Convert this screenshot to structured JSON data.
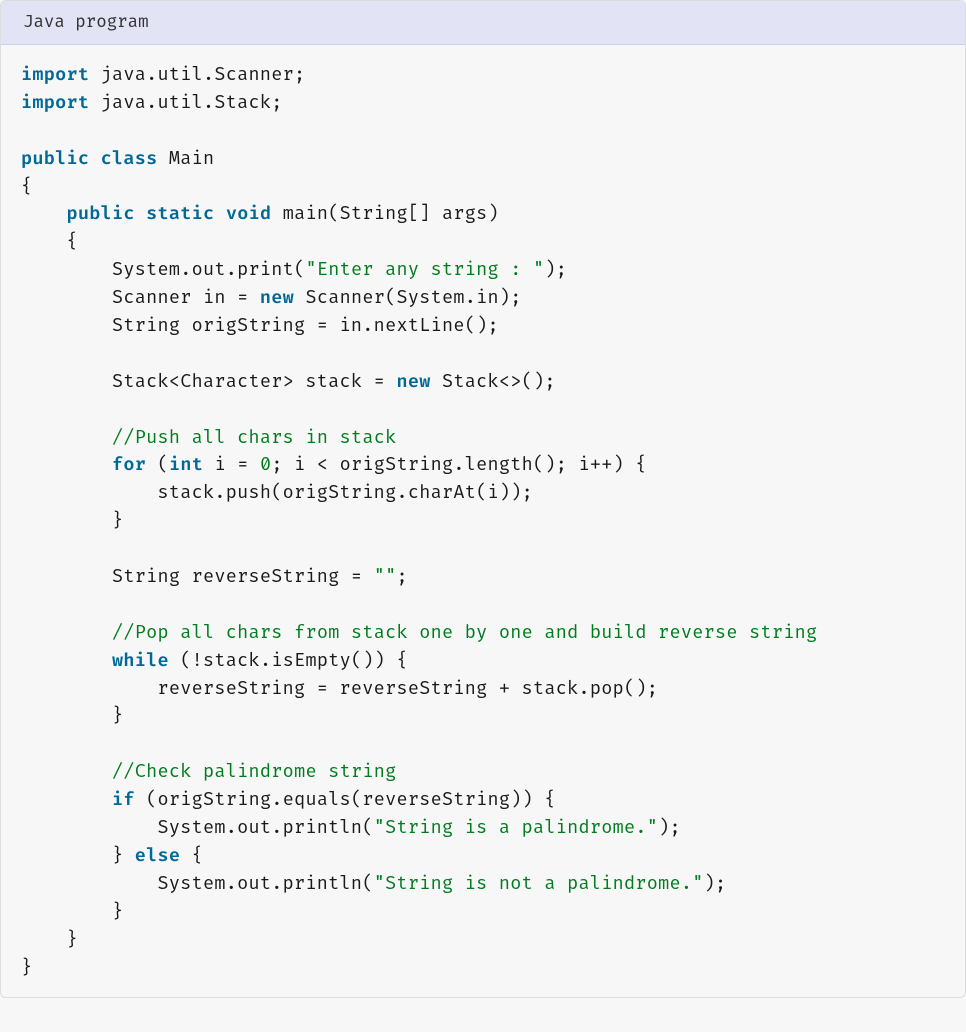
{
  "header": {
    "title": "Java program"
  },
  "code": {
    "lines": [
      [
        [
          "kw",
          "import"
        ],
        [
          "",
          " java.util.Scanner;"
        ]
      ],
      [
        [
          "kw",
          "import"
        ],
        [
          "",
          " java.util.Stack;"
        ]
      ],
      [
        [
          "",
          ""
        ]
      ],
      [
        [
          "kw",
          "public"
        ],
        [
          "",
          " "
        ],
        [
          "kw",
          "class"
        ],
        [
          "",
          " Main"
        ]
      ],
      [
        [
          "",
          "{"
        ]
      ],
      [
        [
          "",
          "    "
        ],
        [
          "kw",
          "public"
        ],
        [
          "",
          " "
        ],
        [
          "kw",
          "static"
        ],
        [
          "",
          " "
        ],
        [
          "kw",
          "void"
        ],
        [
          "",
          " main(String[] args)"
        ]
      ],
      [
        [
          "",
          "    {"
        ]
      ],
      [
        [
          "",
          "        System.out.print("
        ],
        [
          "str",
          "\"Enter any string : \""
        ],
        [
          "",
          ");"
        ]
      ],
      [
        [
          "",
          "        Scanner in = "
        ],
        [
          "kw",
          "new"
        ],
        [
          "",
          " Scanner(System.in);"
        ]
      ],
      [
        [
          "",
          "        String origString = in.nextLine();"
        ]
      ],
      [
        [
          "",
          ""
        ]
      ],
      [
        [
          "",
          "        Stack<Character> stack = "
        ],
        [
          "kw",
          "new"
        ],
        [
          "",
          " Stack<>();"
        ]
      ],
      [
        [
          "",
          ""
        ]
      ],
      [
        [
          "",
          "        "
        ],
        [
          "com",
          "//Push all chars in stack"
        ]
      ],
      [
        [
          "",
          "        "
        ],
        [
          "kw",
          "for"
        ],
        [
          "",
          " ("
        ],
        [
          "kw",
          "int"
        ],
        [
          "",
          " i = "
        ],
        [
          "num",
          "0"
        ],
        [
          "",
          "; i < origString.length(); i++) {"
        ]
      ],
      [
        [
          "",
          "            stack.push(origString.charAt(i));"
        ]
      ],
      [
        [
          "",
          "        }"
        ]
      ],
      [
        [
          "",
          ""
        ]
      ],
      [
        [
          "",
          "        String reverseString = "
        ],
        [
          "str",
          "\"\""
        ],
        [
          "",
          ";"
        ]
      ],
      [
        [
          "",
          ""
        ]
      ],
      [
        [
          "",
          "        "
        ],
        [
          "com",
          "//Pop all chars from stack one by one and build reverse string"
        ]
      ],
      [
        [
          "",
          "        "
        ],
        [
          "kw",
          "while"
        ],
        [
          "",
          " (!stack.isEmpty()) {"
        ]
      ],
      [
        [
          "",
          "            reverseString = reverseString + stack.pop();"
        ]
      ],
      [
        [
          "",
          "        }"
        ]
      ],
      [
        [
          "",
          ""
        ]
      ],
      [
        [
          "",
          "        "
        ],
        [
          "com",
          "//Check palindrome string"
        ]
      ],
      [
        [
          "",
          "        "
        ],
        [
          "kw",
          "if"
        ],
        [
          "",
          " (origString.equals(reverseString)) {"
        ]
      ],
      [
        [
          "",
          "            System.out.println("
        ],
        [
          "str",
          "\"String is a palindrome.\""
        ],
        [
          "",
          ");"
        ]
      ],
      [
        [
          "",
          "        } "
        ],
        [
          "kw",
          "else"
        ],
        [
          "",
          " {"
        ]
      ],
      [
        [
          "",
          "            System.out.println("
        ],
        [
          "str",
          "\"String is not a palindrome.\""
        ],
        [
          "",
          ");"
        ]
      ],
      [
        [
          "",
          "        }"
        ]
      ],
      [
        [
          "",
          "    }"
        ]
      ],
      [
        [
          "",
          "}"
        ]
      ]
    ]
  }
}
